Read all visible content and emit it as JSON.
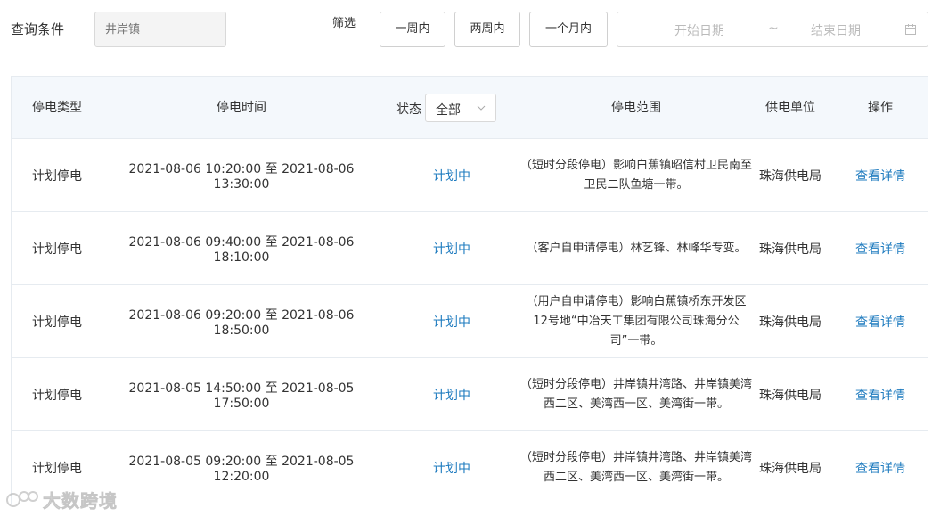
{
  "filter": {
    "query_label": "查询条件",
    "town_placeholder": "井岸镇",
    "screen_label": "筛选",
    "btn_week": "一周内",
    "btn_twoweek": "两周内",
    "btn_month": "一个月内",
    "date_start_placeholder": "开始日期",
    "date_separator": "~",
    "date_end_placeholder": "结束日期"
  },
  "table": {
    "headers": {
      "type": "停电类型",
      "time": "停电时间",
      "status_label": "状态",
      "status_value": "全部",
      "scope": "停电范围",
      "unit": "供电单位",
      "op": "操作"
    },
    "rows": [
      {
        "type": "计划停电",
        "time": "2021-08-06 10:20:00 至 2021-08-06 13:30:00",
        "status": "计划中",
        "scope": "（短时分段停电）影响白蕉镇昭信村卫民南至卫民二队鱼塘一带。",
        "unit": "珠海供电局",
        "op": "查看详情"
      },
      {
        "type": "计划停电",
        "time": "2021-08-06 09:40:00 至 2021-08-06 18:10:00",
        "status": "计划中",
        "scope": "（客户自申请停电）林艺锋、林峰华专变。",
        "unit": "珠海供电局",
        "op": "查看详情"
      },
      {
        "type": "计划停电",
        "time": "2021-08-06 09:20:00 至 2021-08-06 18:50:00",
        "status": "计划中",
        "scope": "（用户自申请停电）影响白蕉镇桥东开发区12号地“中冶天工集团有限公司珠海分公司”一带。",
        "unit": "珠海供电局",
        "op": "查看详情"
      },
      {
        "type": "计划停电",
        "time": "2021-08-05 14:50:00 至 2021-08-05 17:50:00",
        "status": "计划中",
        "scope": "（短时分段停电）井岸镇井湾路、井岸镇美湾西二区、美湾西一区、美湾街一带。",
        "unit": "珠海供电局",
        "op": "查看详情"
      },
      {
        "type": "计划停电",
        "time": "2021-08-05 09:20:00 至 2021-08-05 12:20:00",
        "status": "计划中",
        "scope": "（短时分段停电）井岸镇井湾路、井岸镇美湾西二区、美湾西一区、美湾街一带。",
        "unit": "珠海供电局",
        "op": "查看详情"
      }
    ]
  },
  "watermark": {
    "text": "大数跨境"
  },
  "colors": {
    "link": "#1e7bbf",
    "header_bg": "#f4f8fc",
    "border": "#e6ebf0"
  }
}
